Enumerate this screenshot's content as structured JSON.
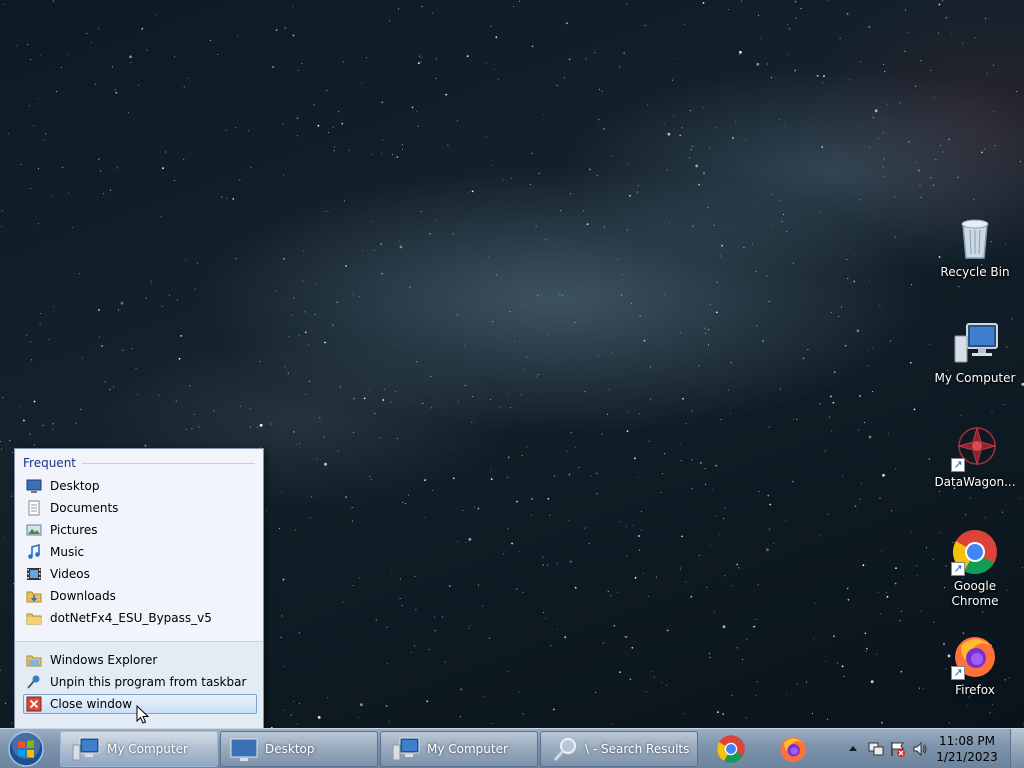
{
  "desktop": {
    "icons": [
      {
        "label": "Recycle Bin",
        "icon": "recycle-bin-icon"
      },
      {
        "label": "My Computer",
        "icon": "computer-icon"
      },
      {
        "label": "DataWagon...",
        "icon": "datawagon-icon"
      },
      {
        "label": "Google Chrome",
        "icon": "chrome-icon"
      },
      {
        "label": "Firefox",
        "icon": "firefox-icon"
      }
    ]
  },
  "jumplist": {
    "section_title": "Frequent",
    "frequent": [
      {
        "label": "Desktop",
        "icon": "desktop-icon"
      },
      {
        "label": "Documents",
        "icon": "documents-icon"
      },
      {
        "label": "Pictures",
        "icon": "pictures-icon"
      },
      {
        "label": "Music",
        "icon": "music-icon"
      },
      {
        "label": "Videos",
        "icon": "videos-icon"
      },
      {
        "label": "Downloads",
        "icon": "downloads-icon"
      },
      {
        "label": "dotNetFx4_ESU_Bypass_v5",
        "icon": "folder-icon"
      }
    ],
    "tasks": [
      {
        "label": "Windows Explorer",
        "icon": "explorer-icon"
      },
      {
        "label": "Unpin this program from taskbar",
        "icon": "unpin-icon"
      },
      {
        "label": "Close window",
        "icon": "close-window-icon"
      }
    ]
  },
  "taskbar": {
    "buttons": [
      {
        "label": "My Computer",
        "icon": "computer-icon",
        "active": true
      },
      {
        "label": "Desktop",
        "icon": "desktop-icon",
        "active": false
      },
      {
        "label": "My Computer",
        "icon": "computer-icon",
        "active": false
      },
      {
        "label": "\\ - Search Results",
        "icon": "search-icon",
        "active": false
      }
    ],
    "pinned": [
      {
        "icon": "chrome-icon"
      },
      {
        "icon": "firefox-icon"
      }
    ],
    "tray": {
      "time": "11:08 PM",
      "date": "1/21/2023"
    }
  },
  "colors": {
    "jumplist_title": "#1e3287",
    "hover_border": "#7da2ce"
  }
}
